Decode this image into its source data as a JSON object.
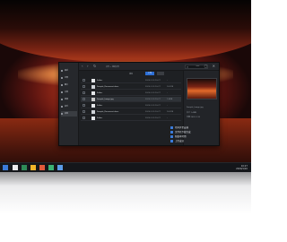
{
  "desktop": {
    "wallpaper": "red-rock-arch-sunrise"
  },
  "window": {
    "breadcrumb": "文件 > 我的文件",
    "controls": "— ▢ ✕",
    "sort_label": "排序",
    "upload_label": "上传"
  },
  "sidebar": {
    "items": [
      {
        "label": "最近"
      },
      {
        "label": "全部"
      },
      {
        "label": "图片"
      },
      {
        "label": "文档"
      },
      {
        "label": "视频"
      },
      {
        "label": "音乐"
      },
      {
        "label": "其他"
      }
    ]
  },
  "files": [
    {
      "name": "Folder",
      "date": "2020-1-10 10:27",
      "size": "-",
      "type": "folder"
    },
    {
      "name": "Sample_Document.docx",
      "date": "2020-1-10 10:27",
      "size": "14.2KB",
      "type": "doc"
    },
    {
      "name": "Folder",
      "date": "2020-1-10 10:27",
      "size": "-",
      "type": "folder"
    },
    {
      "name": "Sample_Image.jpg",
      "date": "2020-1-10 10:27",
      "size": "1.4MB",
      "type": "img"
    },
    {
      "name": "Folder",
      "date": "2020-1-10 10:27",
      "size": "-",
      "type": "folder"
    },
    {
      "name": "Sample_Document.docx",
      "date": "2020-1-10 10:27",
      "size": "14.2KB",
      "type": "doc"
    },
    {
      "name": "Folder",
      "date": "2020-1-10 10:27",
      "size": "-",
      "type": "folder"
    }
  ],
  "details": {
    "meta": [
      "Sample_Image.jpg",
      "大小  1.4MB",
      "日期  2020-1-10"
    ]
  },
  "notifications": [
    "已同步至云端",
    "文件已下载完成",
    "新版本可用",
    "上传成功"
  ],
  "taskbar": {
    "time": "10:27",
    "date": "2020/1/10"
  },
  "colors": {
    "accent": "#2d6fd6",
    "window_bg": "#1e2023"
  }
}
